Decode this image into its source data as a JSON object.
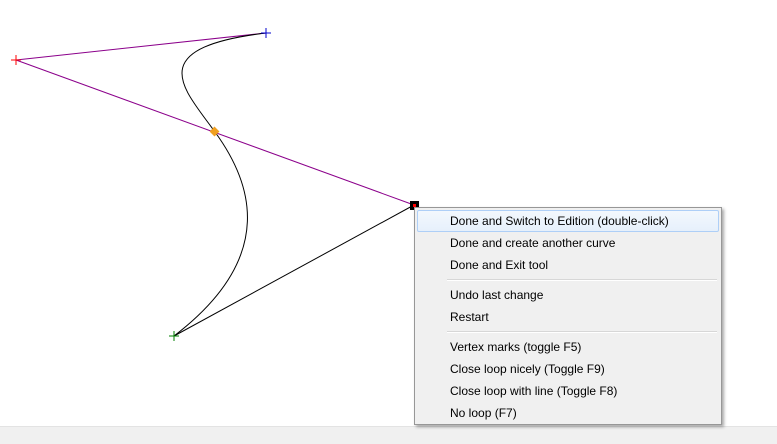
{
  "canvas": {
    "colors": {
      "control_line": "#8b008b",
      "curve": "#000000",
      "start_vertex": "#ff0000",
      "control_vertex": "#0000cc",
      "end_vertex": "#008000",
      "mid_marker": "#f0a020",
      "selected_vertex": "#000000"
    }
  },
  "context_menu": {
    "items": [
      {
        "label": "Done and Switch to Edition (double-click)",
        "highlighted": true
      },
      {
        "label": "Done and create another curve"
      },
      {
        "label": "Done and Exit tool"
      },
      {
        "label": "Undo last change"
      },
      {
        "label": "Restart"
      },
      {
        "label": "Vertex marks (toggle F5)"
      },
      {
        "label": "Close loop nicely (Toggle F9)"
      },
      {
        "label": "Close loop with line (Toggle F8)"
      },
      {
        "label": "No loop (F7)"
      }
    ]
  }
}
